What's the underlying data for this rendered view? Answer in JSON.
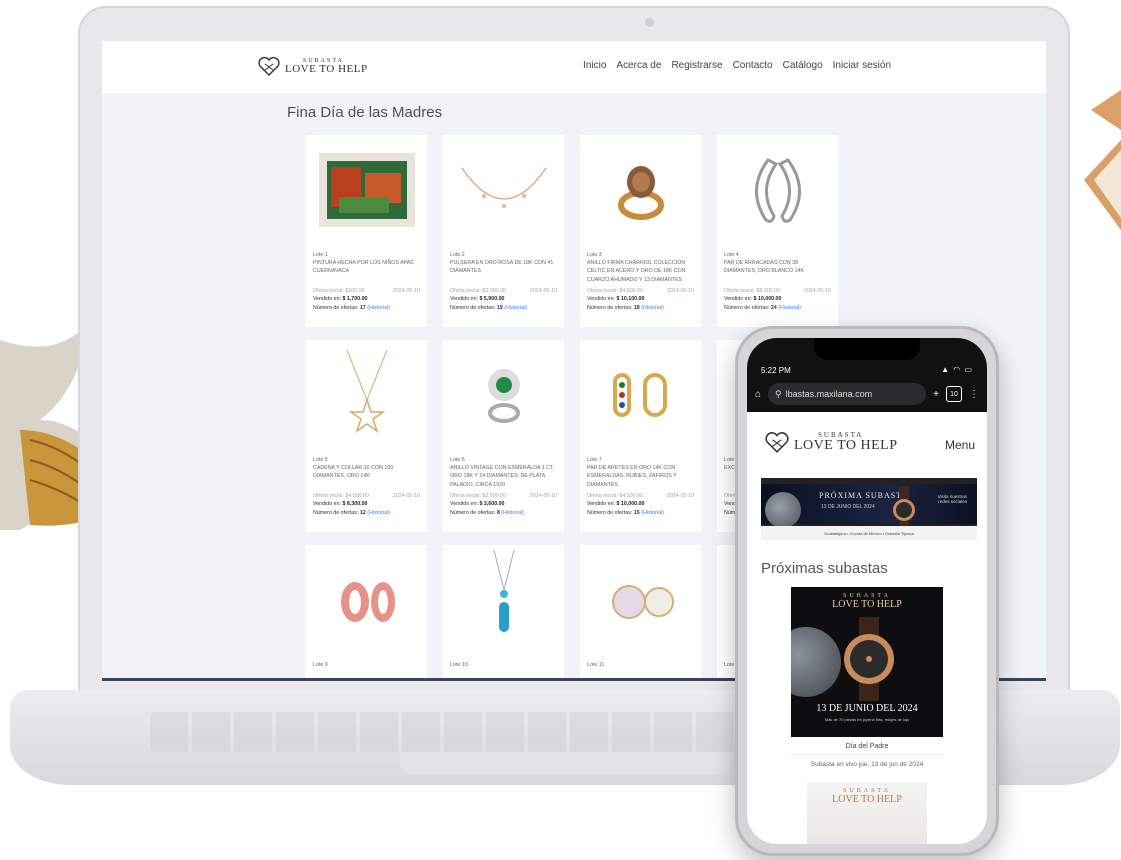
{
  "site": {
    "logo_sub": "SUBASTA",
    "logo_main": "LOVE TO HELP"
  },
  "nav": [
    "Inicio",
    "Acerca de",
    "Registrarse",
    "Contacto",
    "Catálogo",
    "Iniciar sesión"
  ],
  "section_title": "Fina Día de las Madres",
  "lots": [
    {
      "lot": "Lote 1",
      "desc": "PINTURA HECHA POR LOS NIÑOS APAC CUERNAVACA",
      "value_label": "Oferta inicial: $100.00",
      "date": "2024-05-10",
      "sold_label": "Vendido en:",
      "sold": "$ 1,700.00",
      "offers_label": "Número de ofertas:",
      "offers": "17",
      "history": "(Historial)"
    },
    {
      "lot": "Lote 2",
      "desc": "PULSERA EN ORO ROSA DE 18K CON 41 DIAMANTES",
      "value_label": "Oferta inicial: $3,000.00",
      "date": "2024-05-10",
      "sold_label": "Vendido en:",
      "sold": "$ 5,900.00",
      "offers_label": "Número de ofertas:",
      "offers": "19",
      "history": "(Historial)"
    },
    {
      "lot": "Lote 3",
      "desc": "ANILLO FIRMA CHARRIOL COLECCIÓN CELTIC EN ACERO Y ORO DE 18K CON CUARZO AHUMADO Y 13 DIAMANTES",
      "value_label": "Oferta inicial: $4,500.00",
      "date": "2024-05-10",
      "sold_label": "Vendido en:",
      "sold": "$ 10,100.00",
      "offers_label": "Número de ofertas:",
      "offers": "18",
      "history": "(Historial)"
    },
    {
      "lot": "Lote 4",
      "desc": "PAR DE ARRACADAS CON 38 DIAMANTES, ORO BLANCO 14K",
      "value_label": "Oferta inicial: $8,000.00",
      "date": "2024-05-10",
      "sold_label": "Vendido en:",
      "sold": "$ 10,000.00",
      "offers_label": "Número de ofertas:",
      "offers": "24",
      "history": "(Historial)"
    },
    {
      "lot": "Lote 5",
      "desc": "CADENA Y COLLAR 10 CON 100 DIAMANTES, ORO 14K",
      "value_label": "Oferta inicial: $4,500.00",
      "date": "2024-05-10",
      "sold_label": "Vendido en:",
      "sold": "$ 8,300.00",
      "offers_label": "Número de ofertas:",
      "offers": "12",
      "history": "(Historial)"
    },
    {
      "lot": "Lote 6",
      "desc": "ANILLO VINTAGE CON ESMERALDA 1 CT, ORO 18K Y 24 DIAMANTES, DE PLATA PALADIO, CIRCA 1920",
      "value_label": "Oferta inicial: $2,500.00",
      "date": "2024-05-10",
      "sold_label": "Vendido en:",
      "sold": "$ 3,600.00",
      "offers_label": "Número de ofertas:",
      "offers": "8",
      "history": "(Historial)"
    },
    {
      "lot": "Lote 7",
      "desc": "PAR DE ARETES EN ORO 14K CON ESMERALDAS, RUBIES, ZAFIROS Y DIAMANTES",
      "value_label": "Oferta inicial: $4,500.00",
      "date": "2024-05-10",
      "sold_label": "Vendido en:",
      "sold": "$ 10,000.00",
      "offers_label": "Número de ofertas:",
      "offers": "15",
      "history": "(Historial)"
    },
    {
      "lot": "Lote 8",
      "desc": "EXCLUSIVO COLLAR DE ORO",
      "value_label": "Oferta",
      "date": "",
      "sold_label": "Vendido",
      "sold": "",
      "offers_label": "Número",
      "offers": "",
      "history": ""
    },
    {
      "lot": "Lote 9",
      "desc": "",
      "value_label": "",
      "date": "",
      "sold_label": "",
      "sold": "",
      "offers_label": "",
      "offers": "",
      "history": ""
    },
    {
      "lot": "Lote 10",
      "desc": "",
      "value_label": "",
      "date": "",
      "sold_label": "",
      "sold": "",
      "offers_label": "",
      "offers": "",
      "history": ""
    },
    {
      "lot": "Lote 11",
      "desc": "",
      "value_label": "",
      "date": "",
      "sold_label": "",
      "sold": "",
      "offers_label": "",
      "offers": "",
      "history": ""
    },
    {
      "lot": "Lote 12",
      "desc": "",
      "value_label": "",
      "date": "",
      "sold_label": "",
      "sold": "",
      "offers_label": "",
      "offers": "",
      "history": ""
    }
  ],
  "phone": {
    "time": "5:22 PM",
    "status_icons": "▲ ◠ ▭",
    "url": "lbastas.maxilana.com",
    "tab_count": "10",
    "menu_label": "Menu",
    "promo_title": "PRÓXIMA SUBASTA",
    "promo_date": "13 DE JUNIO DEL 2024",
    "promo_note": "Visita nuestras redes sociales",
    "promo_footer": "Guadalajara • Ciudad de México • Subasta Tijuana",
    "upcoming_title": "Próximas subastas",
    "poster_sub": "SUBASTA",
    "poster_main": "LOVE TO HELP",
    "poster_date": "13 DE JUNIO DEL 2024",
    "poster_small": "Más de 70 piezas en joyería fina, relojes de lujo",
    "auction_caption": "Día del Padre",
    "auction_sub": "Subasta en vivo jue, 13 de jun de 2024"
  }
}
